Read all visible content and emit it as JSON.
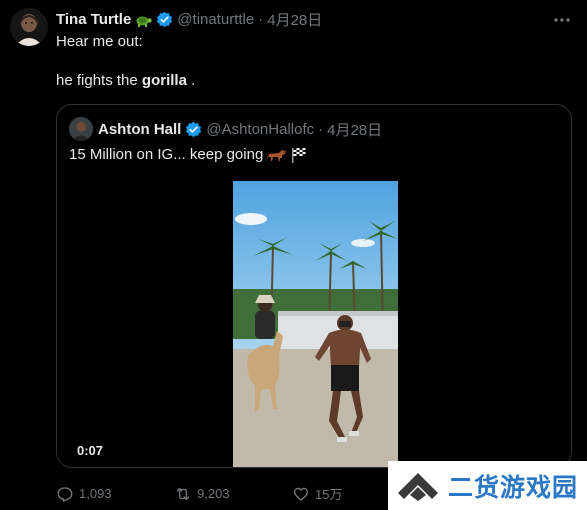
{
  "tweet": {
    "author_name": "Tina Turtle",
    "author_emoji": "turtle-emoji",
    "handle": "@tinaturttle",
    "separator": "·",
    "date": "4月28日",
    "line1": "Hear me out:",
    "line2_prefix": "he fights the ",
    "line2_bold": "gorilla",
    "line2_suffix": " ."
  },
  "quote": {
    "author_name": "Ashton Hall",
    "handle": "@AshtonHallofc",
    "separator": "·",
    "date": "4月28日",
    "text": "15 Million on IG... keep going",
    "emojis": [
      "horse-emoji",
      "checkered-flag-emoji"
    ],
    "video_duration": "0:07"
  },
  "actions": {
    "replies": "1,093",
    "reposts": "9,203",
    "likes": "15万"
  },
  "watermark": {
    "text": "二货游戏园"
  },
  "colors": {
    "background": "#000000",
    "text": "#e7e9ea",
    "muted": "#71767b",
    "verified": "#1d9bf0",
    "border": "#2f3336",
    "watermark_text": "#2a78c6"
  }
}
